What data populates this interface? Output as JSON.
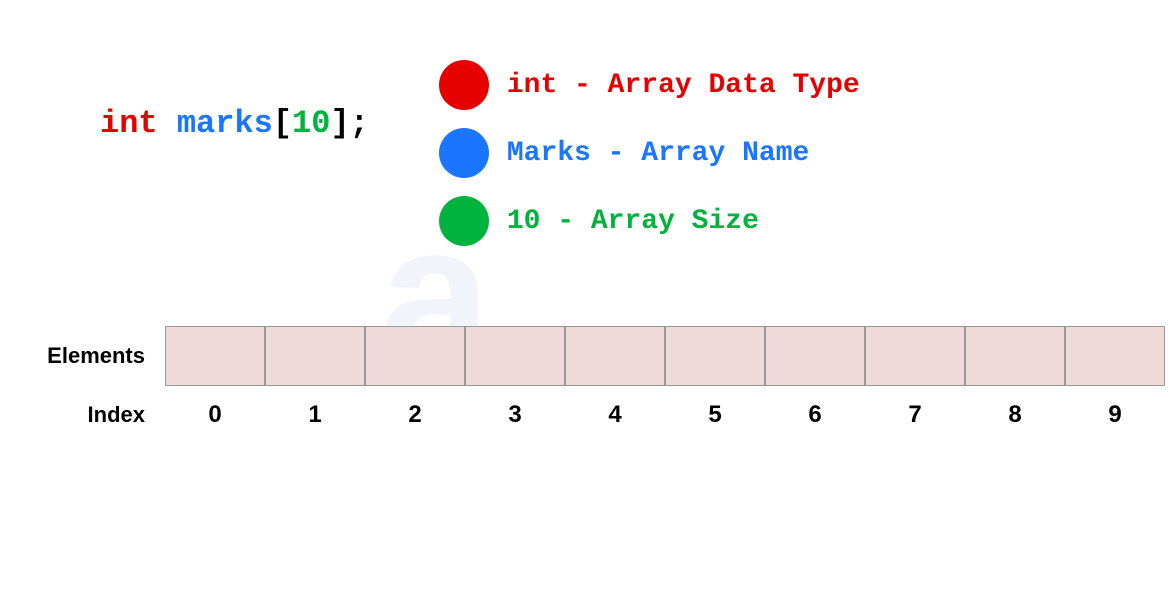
{
  "code": {
    "keyword": "int",
    "name": "marks",
    "bracket_open": "[",
    "size": "10",
    "bracket_close": "]",
    "semicolon": ";"
  },
  "legend": {
    "items": [
      {
        "label": "int - Array Data Type",
        "color_class": "red"
      },
      {
        "label": "Marks - Array Name",
        "color_class": "blue"
      },
      {
        "label": "10 - Array Size",
        "color_class": "green"
      }
    ]
  },
  "array": {
    "elements_label": "Elements",
    "index_label": "Index",
    "indices": [
      "0",
      "1",
      "2",
      "3",
      "4",
      "5",
      "6",
      "7",
      "8",
      "9"
    ],
    "cell_count": 10
  },
  "watermark": "a"
}
